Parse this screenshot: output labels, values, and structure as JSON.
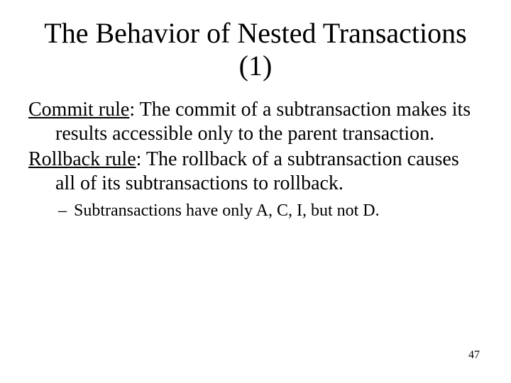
{
  "title": "The Behavior of Nested Transactions (1)",
  "rules": [
    {
      "label": "Commit rule",
      "text": ": The commit of a subtransaction makes its results accessible only to the parent transaction."
    },
    {
      "label": "Rollback rule",
      "text": ": The rollback of a subtransaction causes all of its subtransactions to rollback."
    }
  ],
  "sub_bullet_dash": "–",
  "sub_bullet": "Subtransactions have only A, C, I, but not D.",
  "page_number": "47"
}
